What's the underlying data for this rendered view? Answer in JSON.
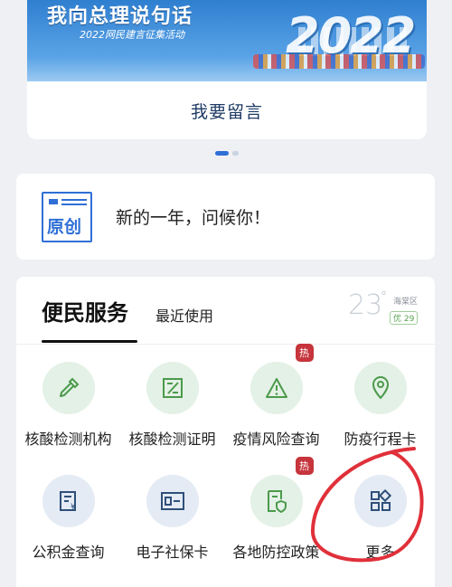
{
  "banner": {
    "title": "我向总理说句话",
    "subtitle": "2022网民建言征集活动",
    "year_art": "2022",
    "action_label": "我要留言"
  },
  "pager": {
    "count": 2,
    "active": 0
  },
  "greeting": {
    "badge_label": "原创",
    "text": "新的一年，问候你！"
  },
  "services": {
    "title": "便民服务",
    "recent_tab": "最近使用",
    "weather": {
      "temperature": "23",
      "degree": "°",
      "district": "海棠区",
      "aqi": "优 29"
    },
    "hot_badge": "热",
    "items": [
      {
        "label": "核酸检测机构",
        "icon": "dropper-icon",
        "style": "green"
      },
      {
        "label": "核酸检测证明",
        "icon": "certificate-icon",
        "style": "green"
      },
      {
        "label": "疫情风险查询",
        "icon": "warning-icon",
        "style": "green",
        "hot": true
      },
      {
        "label": "防疫行程卡",
        "icon": "location-pin-icon",
        "style": "green"
      },
      {
        "label": "公积金查询",
        "icon": "fund-document-icon",
        "style": "blue"
      },
      {
        "label": "电子社保卡",
        "icon": "id-card-icon",
        "style": "blue"
      },
      {
        "label": "各地防控政策",
        "icon": "shield-document-icon",
        "style": "green",
        "hot": true
      },
      {
        "label": "更多",
        "icon": "grid-more-icon",
        "style": "blue"
      }
    ]
  },
  "colors": {
    "accent_blue": "#2f6fd6",
    "hot_red": "#c6343c",
    "green_icon": "#4c9a4c",
    "annotation_red": "#e0303a"
  }
}
